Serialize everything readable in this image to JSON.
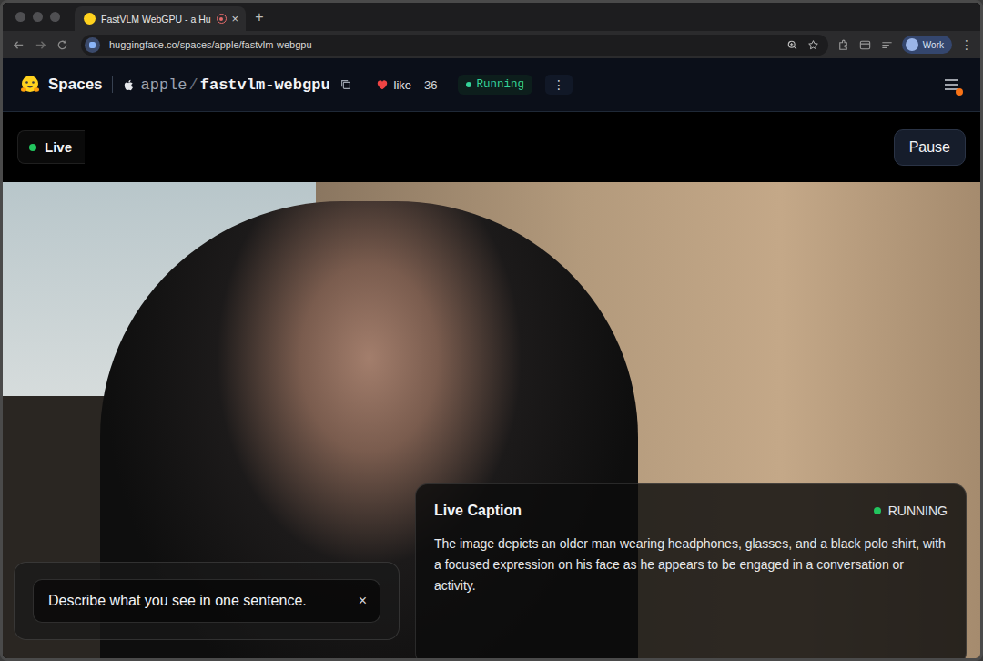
{
  "browser": {
    "tab": {
      "title": "FastVLM WebGPU - a Hu",
      "recording": true,
      "close": "×"
    },
    "new_tab": "+",
    "address": "huggingface.co/spaces/apple/fastvlm-webgpu",
    "profile": "Work",
    "menu": "⋮"
  },
  "header": {
    "section": "Spaces",
    "owner": "apple",
    "separator": "/",
    "repo": "fastvlm-webgpu",
    "like_label": "like",
    "like_count": "36",
    "status": "Running",
    "more": "⋮",
    "notification": true
  },
  "app": {
    "live_badge": "Live",
    "pause_button": "Pause",
    "prompt": {
      "value": "Describe what you see in one sentence.",
      "clear": "×"
    },
    "caption": {
      "title": "Live Caption",
      "status": "RUNNING",
      "text": "The image depicts an older man wearing headphones, glasses, and a black polo shirt, with a focused expression on his face as he appears to be engaged in a conversation or activity."
    }
  }
}
